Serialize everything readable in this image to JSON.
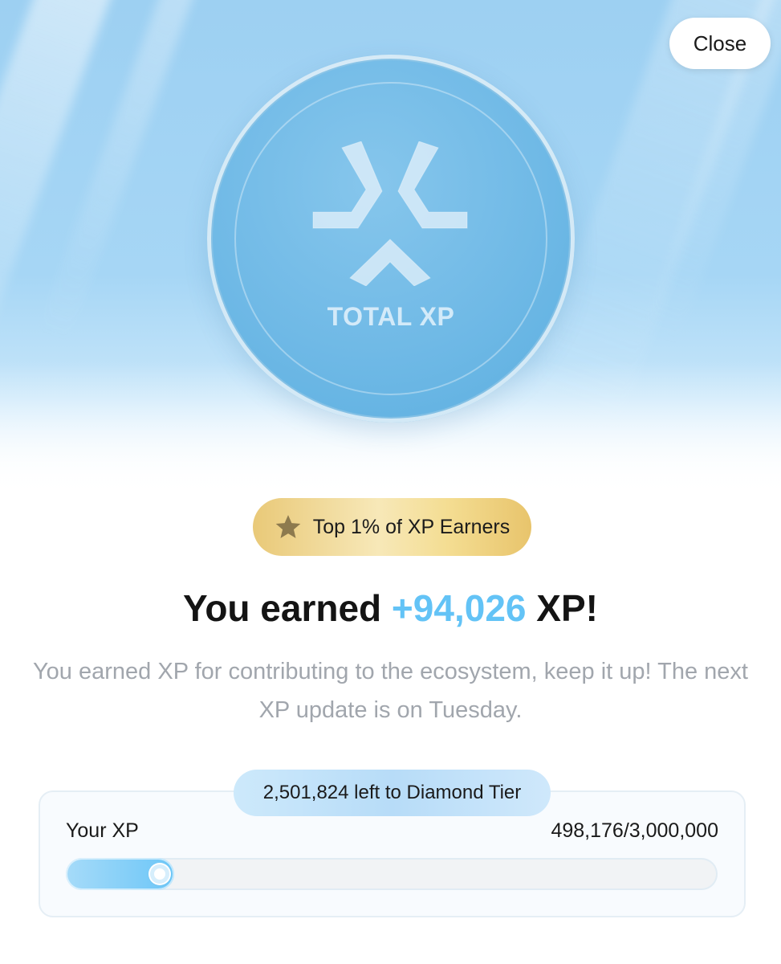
{
  "header": {
    "close_label": "Close"
  },
  "coin": {
    "label": "TOTAL XP",
    "icon": "xp-logo-icon"
  },
  "badge": {
    "icon": "star-icon",
    "text": "Top 1% of XP Earners"
  },
  "headline": {
    "prefix": "You earned",
    "amount": "+94,026",
    "suffix": "XP!"
  },
  "description": "You earned XP for contributing to the ecosystem, keep it up! The next XP update is on Tuesday.",
  "progress": {
    "tier_text": "2,501,824 left to Diamond Tier",
    "label": "Your XP",
    "current_text": "498,176/3,000,000",
    "current": 498176,
    "target": 3000000
  },
  "colors": {
    "accent": "#63c3f6",
    "badge_gold": "#e9c978",
    "hero_blue": "#9dd0f2"
  }
}
